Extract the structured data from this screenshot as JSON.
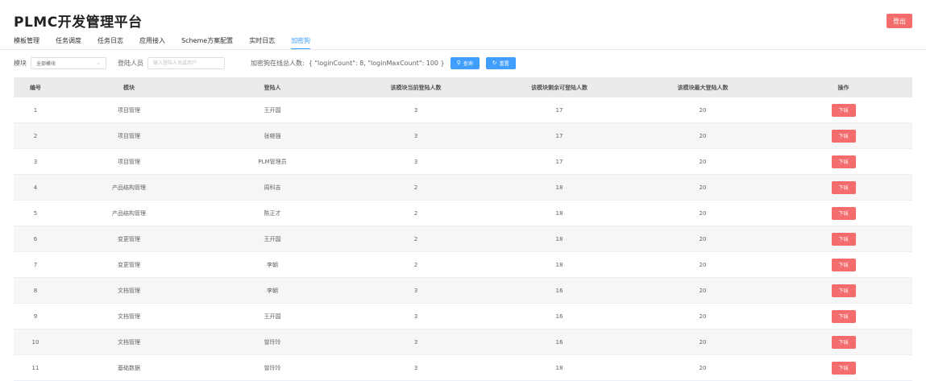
{
  "app": {
    "title": "PLMC开发管理平台",
    "logout_label": "登出"
  },
  "tabs": [
    "模板管理",
    "任务调度",
    "任务日志",
    "应用接入",
    "Scheme方案配置",
    "实时日志",
    "加密狗"
  ],
  "active_tab_index": 6,
  "filters": {
    "module_label": "模块",
    "module_value": "全部模块",
    "user_label": "登陆人员",
    "user_placeholder": "输入登陆人员或用户",
    "summary_label": "加密狗在线总人数:",
    "summary_value": "{ \"loginCount\": 8, \"loginMaxCount\": 100 }",
    "search_label": "查询",
    "reset_label": "重置"
  },
  "table": {
    "columns": [
      "编号",
      "模块",
      "登陆人",
      "该模块当前登陆人数",
      "该模块剩余可登陆人数",
      "该模块最大登陆人数",
      "操作"
    ],
    "action_label": "下线",
    "rows": [
      [
        "1",
        "项目管理",
        "王开国",
        "3",
        "17",
        "20"
      ],
      [
        "2",
        "项目管理",
        "张继强",
        "3",
        "17",
        "20"
      ],
      [
        "3",
        "项目管理",
        "PLM管理员",
        "3",
        "17",
        "20"
      ],
      [
        "4",
        "产品结构管理",
        "周科吉",
        "2",
        "18",
        "20"
      ],
      [
        "5",
        "产品结构管理",
        "陈正才",
        "2",
        "18",
        "20"
      ],
      [
        "6",
        "变更管理",
        "王开国",
        "2",
        "18",
        "20"
      ],
      [
        "7",
        "变更管理",
        "李朝",
        "2",
        "18",
        "20"
      ],
      [
        "8",
        "文档管理",
        "李朝",
        "3",
        "16",
        "20"
      ],
      [
        "9",
        "文档管理",
        "王开国",
        "3",
        "16",
        "20"
      ],
      [
        "10",
        "文档管理",
        "曾玲玲",
        "3",
        "16",
        "20"
      ],
      [
        "11",
        "基础数据",
        "曾玲玲",
        "3",
        "18",
        "20"
      ]
    ]
  },
  "colors": {
    "primary": "#409eff",
    "danger": "#f56c6c",
    "header_bg": "#ebebeb",
    "stripe_bg": "#f6f6f6"
  }
}
